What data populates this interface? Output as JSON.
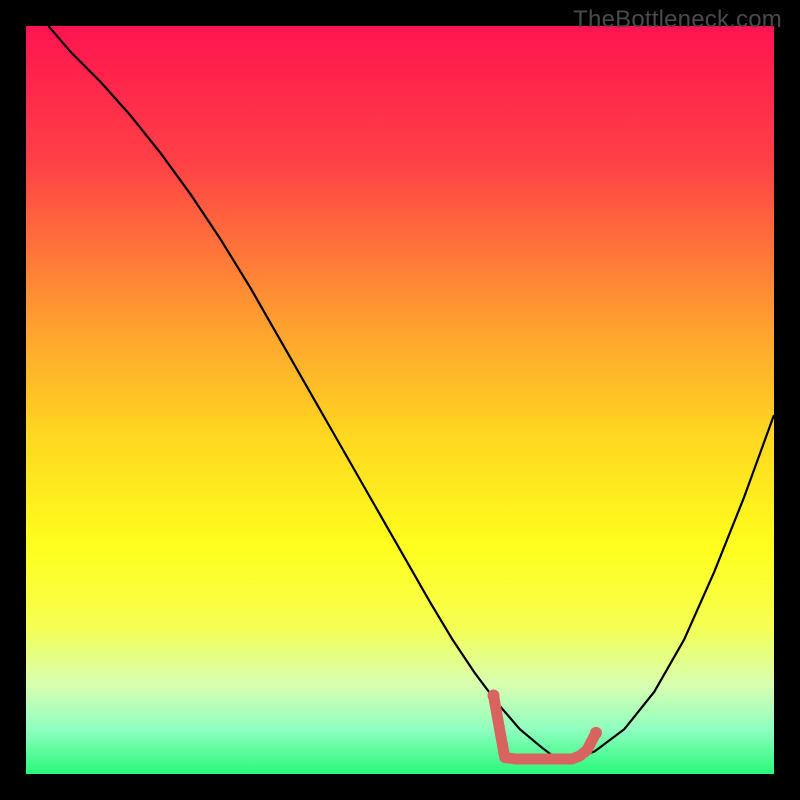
{
  "watermark": "TheBottleneck.com",
  "chart_data": {
    "type": "line",
    "title": "",
    "xlabel": "",
    "ylabel": "",
    "xlim": [
      0,
      100
    ],
    "ylim": [
      0,
      100
    ],
    "gradient_stops": [
      {
        "offset": 0,
        "color": "#ff1450"
      },
      {
        "offset": 18,
        "color": "#ff4046"
      },
      {
        "offset": 40,
        "color": "#ffa030"
      },
      {
        "offset": 55,
        "color": "#ffd820"
      },
      {
        "offset": 70,
        "color": "#ffff1e"
      },
      {
        "offset": 80,
        "color": "#f5ff50"
      },
      {
        "offset": 88,
        "color": "#d8ffb0"
      },
      {
        "offset": 94,
        "color": "#90ffc0"
      },
      {
        "offset": 100,
        "color": "#28f878"
      }
    ],
    "series": [
      {
        "name": "bottleneck-curve",
        "color": "#000000",
        "width": 2.2,
        "x": [
          3,
          6,
          10,
          14,
          18,
          22,
          26,
          30,
          34,
          38,
          42,
          46,
          50,
          54,
          57,
          60,
          63,
          66,
          69,
          71,
          73,
          76,
          80,
          84,
          88,
          92,
          96,
          100
        ],
        "y": [
          100,
          96.5,
          92.5,
          88,
          83,
          77.5,
          71.5,
          65,
          58,
          51,
          44,
          37,
          30,
          23,
          18,
          13.5,
          9.5,
          6,
          3.5,
          2,
          2,
          3,
          6,
          11,
          18,
          27,
          37,
          48
        ]
      },
      {
        "name": "optimal-range-marker",
        "color": "#d9645f",
        "width": 11,
        "linecap": "round",
        "x": [
          62.5,
          64,
          65.5,
          67,
          68,
          69,
          70,
          71,
          72,
          73,
          74,
          75,
          76.2
        ],
        "y": [
          10.5,
          2.2,
          2,
          2,
          2,
          2,
          2,
          2,
          2,
          2,
          2.4,
          3.2,
          5.5
        ]
      }
    ],
    "marker_dots": [
      {
        "x": 62.5,
        "y": 10.5,
        "r": 6,
        "color": "#d9645f"
      },
      {
        "x": 76.2,
        "y": 5.5,
        "r": 6,
        "color": "#d9645f"
      }
    ]
  }
}
